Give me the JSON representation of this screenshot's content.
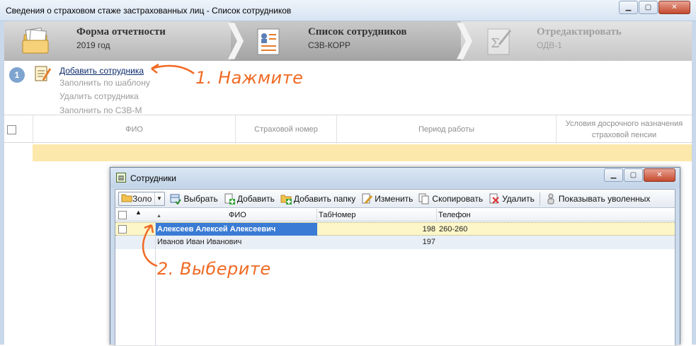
{
  "window": {
    "title": "Сведения о страховом стаже застрахованных лиц - Список сотрудников",
    "minimize": "▁",
    "maximize": "▢",
    "close": "✕"
  },
  "wizard": {
    "steps": [
      {
        "title": "Форма отчетности",
        "subtitle": "2019 год",
        "state": "done"
      },
      {
        "title": "Список сотрудников",
        "subtitle": "СЗВ-КОРР",
        "state": "current"
      },
      {
        "title": "Отредактировать",
        "subtitle": "ОДВ-1",
        "state": "disabled"
      }
    ]
  },
  "actions": {
    "step_number": "1",
    "items": [
      {
        "label": "Добавить сотрудника",
        "enabled": true
      },
      {
        "label": "Заполнить по шаблону",
        "enabled": false
      },
      {
        "label": "Удалить сотрудника",
        "enabled": false
      },
      {
        "label": "Заполнить по СЗВ-М",
        "enabled": false
      }
    ]
  },
  "annotations": {
    "first": "1. Нажмите",
    "second": "2. Выберите",
    "color": "#f06a24"
  },
  "main_grid": {
    "columns": [
      "ФИО",
      "Страховой номер",
      "Период работы",
      "Условия досрочного назначения страховой пенсии"
    ]
  },
  "dialog": {
    "title": "Сотрудники",
    "minimize": "▁",
    "maximize": "▢",
    "close": "✕",
    "toolbar": {
      "filter_value": "Золо",
      "select": "Выбрать",
      "add": "Добавить",
      "add_folder": "Добавить папку",
      "edit": "Изменить",
      "copy": "Скопировать",
      "delete": "Удалить",
      "show_dismissed": "Показывать уволенных"
    },
    "list": {
      "columns": [
        "ФИО",
        "ТабНомер",
        "Телефон"
      ],
      "rows": [
        {
          "fio": "Алексеев Алексей Алексеевич",
          "tab": "198",
          "phone": "260-260",
          "selected": true
        },
        {
          "fio": "Иванов Иван Иванович",
          "tab": "197",
          "phone": "",
          "selected": false
        }
      ]
    }
  },
  "colors": {
    "accent": "#3a7bd5",
    "selected_row": "#fdf6c8",
    "highlight_row": "#fde8ab"
  }
}
